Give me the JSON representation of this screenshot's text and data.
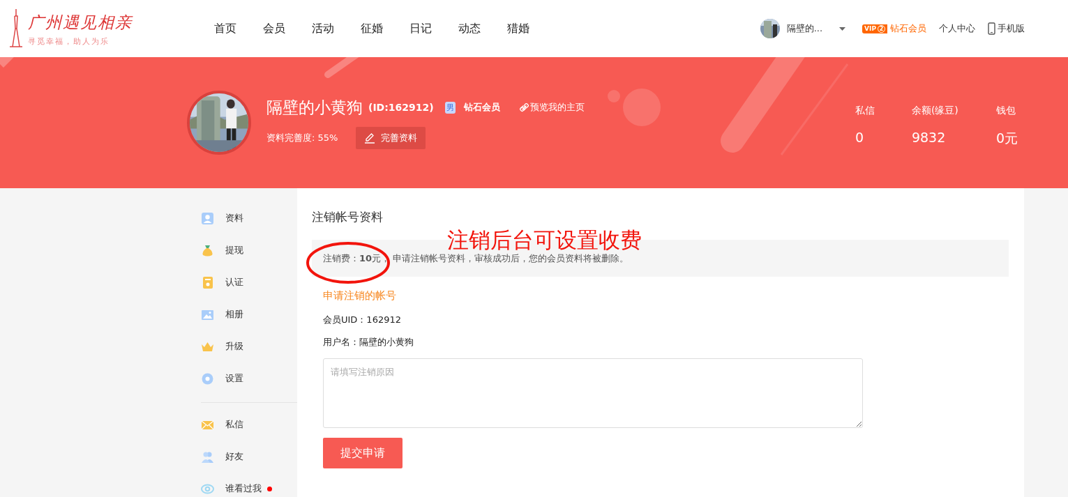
{
  "logo": {
    "title": "广州遇见相亲",
    "slogan": "寻觅幸福，助人为乐"
  },
  "nav": [
    "首页",
    "会员",
    "活动",
    "征婚",
    "日记",
    "动态",
    "猎婚"
  ],
  "user_menu": {
    "name": "隔壁的...",
    "vip_label": "VIP",
    "vip_grade": "2",
    "membership": "钻石会员",
    "links": [
      "个人中心",
      "手机版"
    ]
  },
  "profile": {
    "name": "隔壁的小黄狗",
    "id": "(ID:162912)",
    "gender": "男",
    "membership": "钻石会员",
    "preview_link": "预览我的主页",
    "completeness": "资料完善度: 55%",
    "edit_button": "完善资料",
    "stats": [
      {
        "label": "私信",
        "value": "0"
      },
      {
        "label": "余额(缘豆)",
        "value": "9832"
      },
      {
        "label": "钱包",
        "value": "0元"
      }
    ]
  },
  "sidebar": {
    "groups": [
      [
        {
          "label": "资料",
          "dot": false
        },
        {
          "label": "提现",
          "dot": false
        },
        {
          "label": "认证",
          "dot": false
        },
        {
          "label": "相册",
          "dot": false
        },
        {
          "label": "升级",
          "dot": false
        },
        {
          "label": "设置",
          "dot": false
        }
      ],
      [
        {
          "label": "私信",
          "dot": false
        },
        {
          "label": "好友",
          "dot": false
        },
        {
          "label": "谁看过我",
          "dot": true
        }
      ]
    ]
  },
  "content": {
    "title": "注销帐号资料",
    "notice": "注销费：**10**元， 申请注销帐号资料，审核成功后，您的会员资料将被删除。",
    "section_title": "申请注销的帐号",
    "fields": [
      "会员UID：162912",
      "用户名：隔壁的小黄狗"
    ],
    "reason_placeholder": "请填写注销原因",
    "submit_button": "提交申请"
  },
  "annotation": {
    "text": "注销后台可设置收费"
  }
}
